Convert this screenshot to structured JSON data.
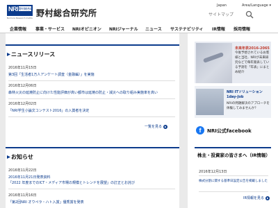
{
  "header": {
    "logo_text": "NRI",
    "logo_sub": "野村総合研究所",
    "logo_under": "Nomura Research Institute",
    "company_name": "野村総合研究所",
    "sitemap_placeholder": "サイトマップ",
    "lang_jp": "Japan",
    "lang_select": "Area/Language ▾"
  },
  "nav": {
    "items": [
      "企業情報",
      "事業・サービス",
      "NRIオピニオン",
      "NRIジャーナル",
      "ニュース",
      "サステナビリティ",
      "IR情報",
      "採用情報"
    ]
  },
  "news_release": {
    "title": "ニュースリリース",
    "items": [
      {
        "date": "2016年11月15日",
        "text": "第3回「生活者1万人アンケート調査（金融編）」を実施"
      },
      {
        "date": "2016年12月06日",
        "text": "森林火災の延焼防止に向けた性能評価が高い都市は延焼の防止・減災への取り組み実施率を高い"
      },
      {
        "date": "2016年12月02日",
        "text": "「NRI学生小論文コンテスト2016」の入賞者を決定"
      }
    ],
    "more": "一覧を見る"
  },
  "notices": {
    "title": "お知らせ",
    "items": [
      {
        "date": "2016年11月22日",
        "text": "2016年11月21日発表資料"
      },
      {
        "date": "",
        "text": "「2022 年度までのICT・メディア市場の規模とトレンドを展望」の訂正とお詫び"
      },
      {
        "date": "2016年11月16日",
        "text": "「第2回NRI オウペラ・ハト入賞」優秀賞を発表"
      }
    ]
  },
  "side": {
    "ad1_title": "未来年表2016-2065",
    "ad1_body": "今後予想されているお客様と当社、NRIが未来研究などで毎年発表している予測を「年表」にまとめ紹介",
    "ad2_title": "NRI ITソリューション 1day-Job",
    "ad2_body": "NRIの問題解決のアプローチを体験してみませんか？",
    "fb_label": "NRI公式facebook",
    "ir_title": "株主・投資家の皆さまへ（IR情報）",
    "ir_date": "2016年12月13日",
    "ir_link": "株式分割に関する基準日設定公告を掲載しました",
    "ir_more": "IR情報を見る"
  },
  "colors": {
    "brand": "#0b3b8c",
    "accent_red": "#c0392b",
    "facebook": "#1877f2"
  }
}
